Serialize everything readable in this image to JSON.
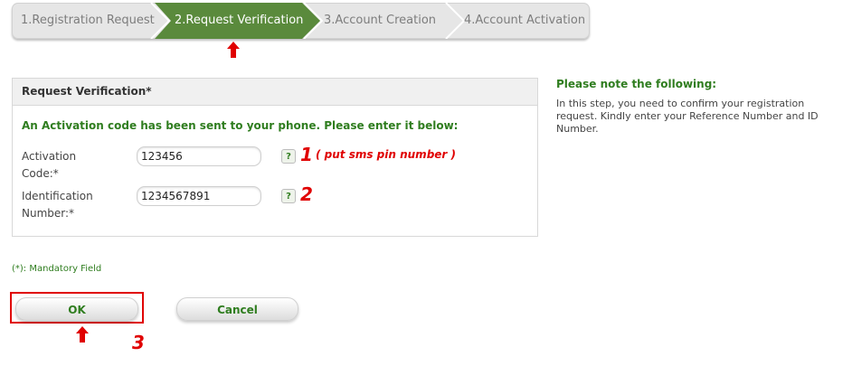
{
  "wizard": {
    "steps": [
      {
        "label": "1.Registration Request",
        "active": false
      },
      {
        "label": "2.Request Verification",
        "active": true
      },
      {
        "label": "3.Account Creation",
        "active": false
      },
      {
        "label": "4.Account Activation",
        "active": false
      }
    ],
    "active_color": "#5a8a3c",
    "inactive_color": "#e6e6e6"
  },
  "form": {
    "title": "Request Verification*",
    "instruction": "An Activation code has been sent to your phone. Please enter it below:",
    "fields": [
      {
        "label_line1": "Activation",
        "label_line2": "Code:*",
        "value": "123456",
        "help": "?"
      },
      {
        "label_line1": "Identification",
        "label_line2": "Number:*",
        "value": "1234567891",
        "help": "?"
      }
    ]
  },
  "annotations": {
    "one": "1",
    "one_note": "( put sms pin number )",
    "two": "2",
    "three": "3",
    "color": "#e00000"
  },
  "note": {
    "title": "Please note the following:",
    "text": "In this step, you need to confirm your registration request. Kindly enter your Reference Number and ID Number."
  },
  "mandatory": "(*): Mandatory Field",
  "buttons": {
    "ok": "OK",
    "cancel": "Cancel"
  },
  "colors": {
    "accent_green": "#2f7d1f"
  }
}
